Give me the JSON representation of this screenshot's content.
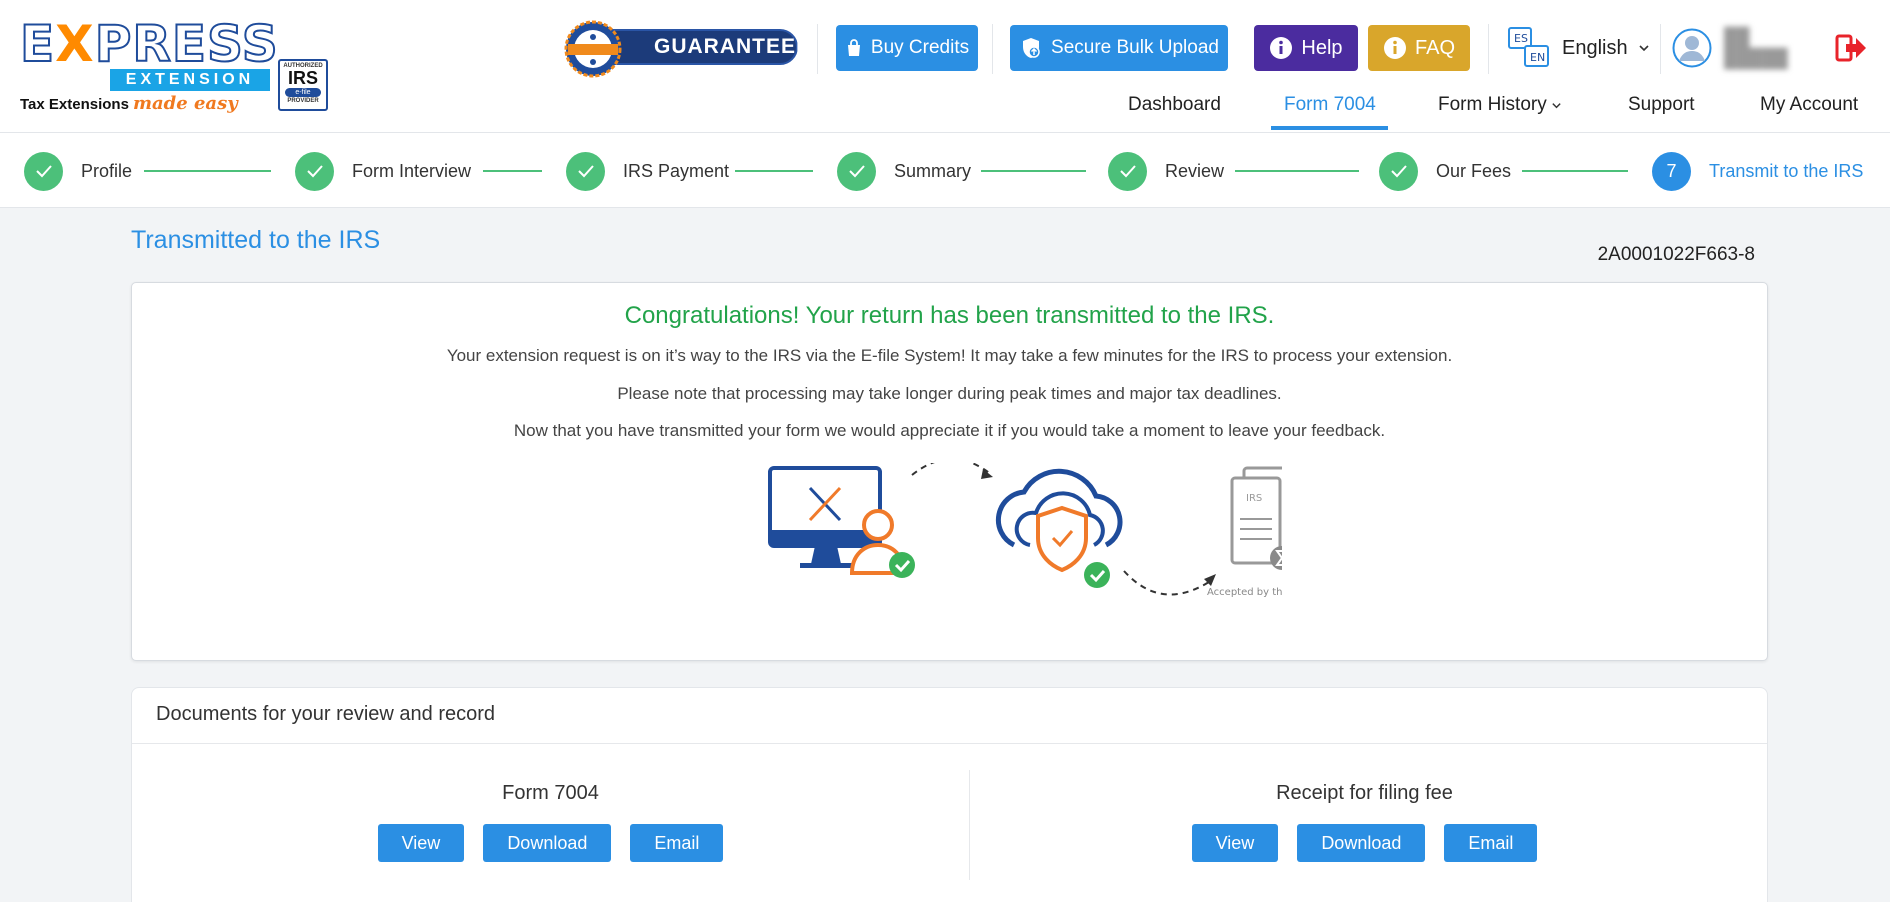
{
  "brand": {
    "logo_word_pre": "E",
    "logo_word_x": "X",
    "logo_word_post": "PRESS",
    "logo_bar": "EXTENSION",
    "logo_tag": "Tax Extensions",
    "logo_tag_easy": "made easy",
    "irs_badge_top": "AUTHORIZED",
    "irs_badge_main": "IRS",
    "irs_badge_efile": "e-file",
    "irs_badge_bottom": "PROVIDER"
  },
  "header": {
    "guarantee_label": "GUARANTEED",
    "buttons": {
      "buy_credits": "Buy Credits",
      "bulk_upload": "Secure Bulk Upload",
      "help": "Help",
      "faq": "FAQ"
    },
    "language": {
      "selected": "English",
      "icon_codes": [
        "ES",
        "EN"
      ]
    },
    "logout_icon": "logout-icon"
  },
  "nav": {
    "items": [
      {
        "label": "Dashboard"
      },
      {
        "label": "Form 7004",
        "active": true
      },
      {
        "label": "Form History"
      },
      {
        "label": "Support"
      },
      {
        "label": "My Account"
      }
    ]
  },
  "stepper": {
    "steps": [
      {
        "label": "Profile",
        "status": "done"
      },
      {
        "label": "Form Interview",
        "status": "done"
      },
      {
        "label": "IRS Payment",
        "status": "done"
      },
      {
        "label": "Summary",
        "status": "done"
      },
      {
        "label": "Review",
        "status": "done"
      },
      {
        "label": "Our Fees",
        "status": "done"
      },
      {
        "label": "Transmit to the IRS",
        "status": "current",
        "number": "7"
      }
    ]
  },
  "main": {
    "title": "Transmitted to the IRS",
    "submission_id": "2A0001022F663-8",
    "congrats": "Congratulations! Your return has been transmitted to the IRS.",
    "messages": [
      "Your extension request is on it’s way to the IRS via the E-file System! It may take a few minutes for the IRS to process your extension.",
      "Please note that processing may take longer during peak times and major tax deadlines.",
      "Now that you have transmitted your form we would appreciate it if you would take a moment to leave your feedback."
    ],
    "illustration": {
      "doc_label": "IRS",
      "accepted_label": "Accepted by the IRS"
    }
  },
  "documents": {
    "title": "Documents for your review and record",
    "items": [
      {
        "name": "Form 7004",
        "view": "View",
        "download": "Download",
        "email": "Email"
      },
      {
        "name": "Receipt for filing fee",
        "view": "View",
        "download": "Download",
        "email": "Email"
      }
    ]
  },
  "colors": {
    "primary_blue": "#2b8fe3",
    "success_green": "#4cc07a",
    "congrats_green": "#22a34a",
    "help_purple": "#4b2c9f",
    "faq_gold": "#d9a62b",
    "logout_red": "#e8232a"
  }
}
